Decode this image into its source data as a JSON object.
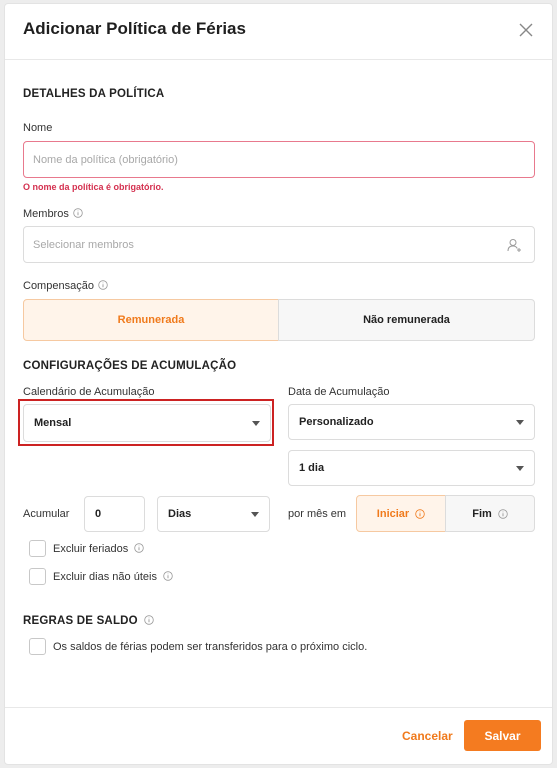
{
  "dialog": {
    "title": "Adicionar Política de Férias",
    "close_icon": "close-icon"
  },
  "details": {
    "heading": "DETALHES DA POLÍTICA",
    "name_label": "Nome",
    "name_placeholder": "Nome da política (obrigatório)",
    "name_error": "O nome da política é obrigatório.",
    "members_label": "Membros",
    "members_placeholder": "Selecionar membros",
    "members_icon": "add-user-icon",
    "compensation_label": "Compensação",
    "compensation_options": [
      "Remunerada",
      "Não remunerada"
    ],
    "compensation_selected": "Remunerada"
  },
  "accrual": {
    "heading": "CONFIGURAÇÕES DE ACUMULAÇÃO",
    "calendar_label": "Calendário de Acumulação",
    "calendar_value": "Mensal",
    "date_label": "Data de Acumulação",
    "date_value": "Personalizado",
    "day_value": "1 dia",
    "accrue_label": "Acumular",
    "accrue_amount": "0",
    "unit_value": "Dias",
    "per_month_label": "por mês em",
    "period_options": [
      "Iniciar",
      "Fim"
    ],
    "period_selected": "Iniciar",
    "exclude_holidays": "Excluir feriados",
    "exclude_nonworking": "Excluir dias não úteis"
  },
  "balance": {
    "heading": "REGRAS DE SALDO",
    "carryover_label": "Os saldos de férias podem ser transferidos para o próximo ciclo."
  },
  "footer": {
    "cancel_label": "Cancelar",
    "save_label": "Salvar"
  },
  "colors": {
    "accent": "#f47b20",
    "error": "#d4304f",
    "selected_bg": "#fff4ea",
    "highlight_border": "#cc2222"
  }
}
